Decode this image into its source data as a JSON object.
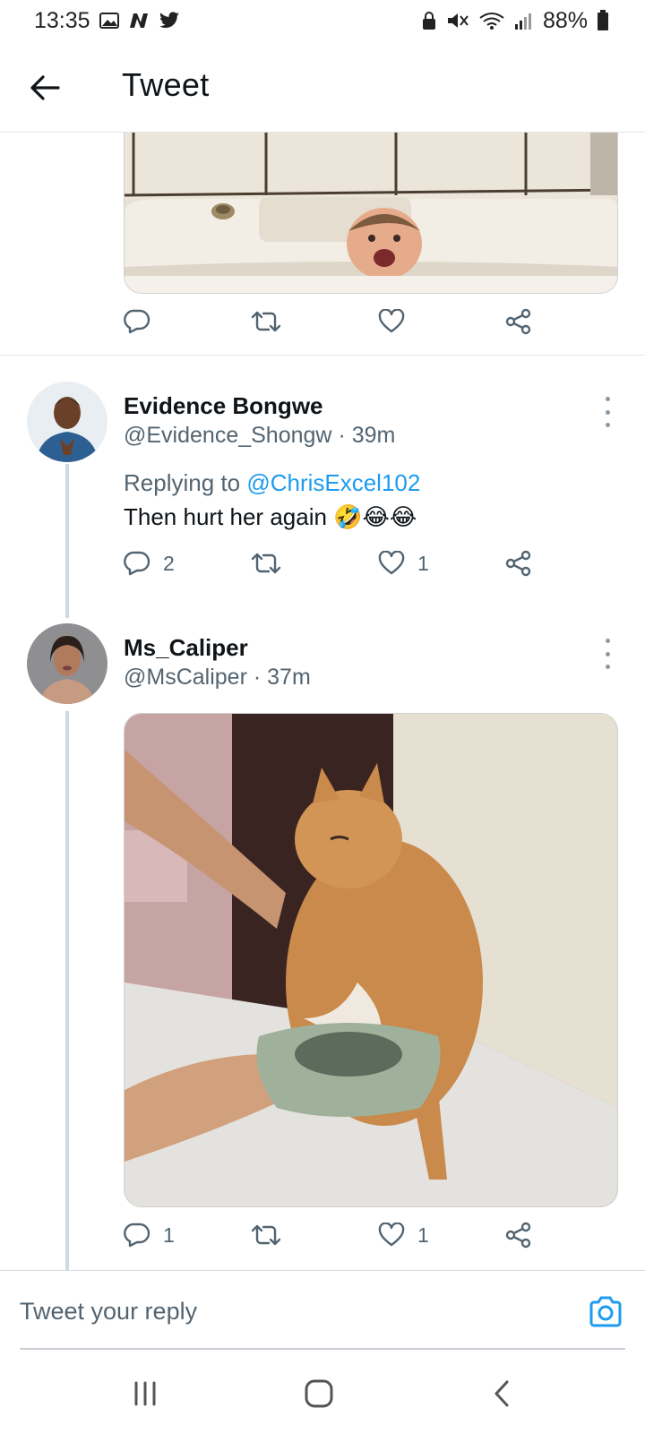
{
  "status_bar": {
    "time": "13:35",
    "battery": "88%",
    "left_icons": [
      "gallery-icon",
      "n-app-icon",
      "twitter-bird-icon"
    ],
    "right_icons": [
      "lock-icon",
      "mute-icon",
      "wifi-icon",
      "signal-icon",
      "battery-icon"
    ]
  },
  "header": {
    "title": "Tweet"
  },
  "top_tweet": {
    "actions": {
      "reply": "",
      "retweet": "",
      "like": ""
    }
  },
  "tweets": [
    {
      "display_name": "Evidence Bongwe",
      "handle": "@Evidence_Shongw",
      "separator": "·",
      "time": "39m",
      "replying_prefix": "Replying to",
      "replying_handle": "@ChrisExcel102",
      "text": "Then hurt her again",
      "emojis": "🤣😂😂",
      "reply_count": "2",
      "retweet_count": "",
      "like_count": "1"
    },
    {
      "display_name": "Ms_Caliper",
      "handle": "@MsCaliper",
      "separator": "·",
      "time": "37m",
      "reply_count": "1",
      "retweet_count": "",
      "like_count": "1"
    }
  ],
  "composer": {
    "placeholder": "Tweet your reply"
  },
  "colors": {
    "accent": "#1d9bf0",
    "text_secondary": "#536471",
    "thread_line": "#cfd9de"
  }
}
